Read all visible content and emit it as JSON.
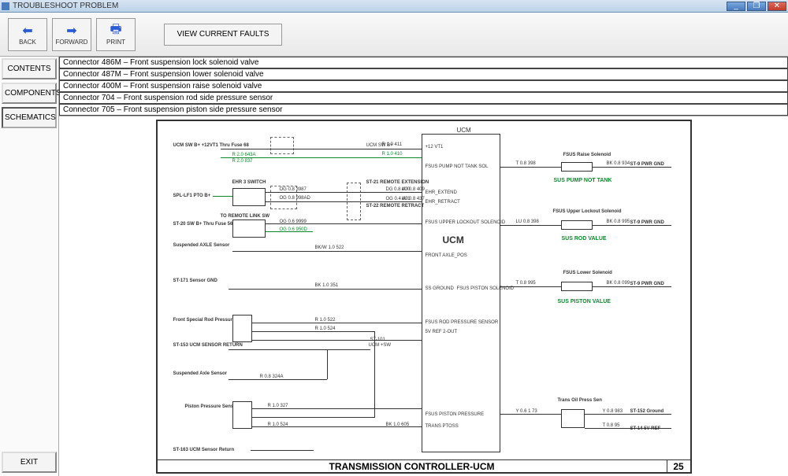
{
  "window": {
    "title": "TROUBLESHOOT PROBLEM",
    "minimize": "_",
    "maximize": "❐",
    "close": "✕"
  },
  "toolbar": {
    "back": {
      "label": "BACK",
      "glyph": "⬅"
    },
    "forward": {
      "label": "FORWARD",
      "glyph": "➡"
    },
    "print": {
      "label": "PRINT",
      "glyph": "🖶"
    },
    "view_faults": "VIEW CURRENT FAULTS"
  },
  "sidebar": {
    "contents": "CONTENTS",
    "components": "COMPONENTS",
    "schematics": "SCHEMATICS",
    "exit": "EXIT"
  },
  "connectors": [
    "Connector 486M – Front suspension lock solenoid valve",
    "Connector 487M – Front suspension lower solenoid valve",
    "Connector 400M – Front suspension raise solenoid valve",
    "Connector 704 – Front suspension rod side pressure sensor",
    "Connector 705 – Front suspension piston side pressure sensor"
  ],
  "schematic": {
    "title": "TRANSMISSION CONTROLLER-UCM",
    "page": "25",
    "ucm_heading": "UCM",
    "ucm_big": "UCM",
    "left": {
      "ucm_sw": "UCM SW B+\n+12VT1 Thru Fuse 68",
      "ehr_switch": "EHR 3 SWITCH",
      "spl": "SPL-LF1 PTO B+",
      "remote_link": "TO REMOTE LINK SW",
      "st20": "ST-20 SW B+ Thru\nFuse 56",
      "susp_axle": "Suspended AXLE Sensor",
      "st171": "ST-171 Sensor GND",
      "front_rod": "Front Special Rod\nPressure Sensor",
      "st153": "ST-153 UCM SENSOR RETURN",
      "susp_axle2": "Suspended Axle Sensor",
      "piston": "Piston\nPressure Sensor",
      "st163": "ST-163 UCM Sensor Return"
    },
    "mid": {
      "ucm_sw_b": "UCM SW B+",
      "st21": "ST-21\nREMOTE EXTENSION",
      "st22": "ST-22\nREMOTE RETRACT",
      "ucm_sw2": "UCM +SW",
      "st101": "ST-101"
    },
    "inside": {
      "v12": "+12 VT1",
      "pump": "FSUS PUMP NOT TANK SOL",
      "ehr_ext": "EHR_EXTEND",
      "ehr_ret": "EHR_RETRACT",
      "upper": "FSUS UPPER LOCKOUT SOLENOID",
      "axle_pos": "FRONT AXLE_POS",
      "ss_gnd": "SS GROUND",
      "piston_sol": "FSUS PISTON SOLENOID",
      "rod_press": "FSUS ROD PRESSURE SENSOR",
      "sv_ref": "5V REF 2-OUT",
      "piston_press": "FSUS PISTON PRESSURE",
      "trans": "TRANS PTOSS"
    },
    "right": {
      "raise": "FSUS Raise\nSolenoid",
      "st9a": "ST-9 PWR GND",
      "sus_pump": "SUS PUMP NOT TANK",
      "upper_lock": "FSUS Upper Lockout\nSolenoid",
      "st9b": "ST-9 PWR GND",
      "sus_rod": "SUS ROD VALUE",
      "lower": "FSUS Lower\nSolenoid",
      "st9c": "ST-9 PWR GND",
      "sus_piston": "SUS PISTON VALUE",
      "trans_oil": "Trans Oil Press\nSen",
      "st152": "ST-152 Ground",
      "st14": "ST-14 5V REF"
    },
    "wires": {
      "r10411": "R 1.0 411",
      "r10410": "R 1.0 410",
      "r20643a": "R 2.0 643A",
      "r20837": "R 2.0 837",
      "og083987": "OG 0.8 3987",
      "dg08400": "DG 0.8 400",
      "og04401": "OG 0.4 401",
      "og08998ad": "OG 0.8 998AD",
      "og069999": "OG 0.6 9999",
      "og06950d": "OG 0.6 950D",
      "lu08409": "LU 0.8 409",
      "lu08437": "LU 0.8 437",
      "bkw10522": "BK/W 1.0 522",
      "bk10351": "BK 1.0 351",
      "r10522a": "R 1.0 522",
      "r10524": "R 1.0 524",
      "r08324a": "R 0.8 324A",
      "r10327": "R 1.0 327",
      "r10524b": "R 1.0 524",
      "y06173": "Y 0.6 1 73",
      "bk08934": "BK 0.8 934",
      "t08398": "T 0.8 398",
      "lu08398": "LU 0.8 398",
      "t08995": "T 0.8 995",
      "bk08995": "BK 0.8 995",
      "bk08office": "BK 0.8 099",
      "y08983": "Y 0.8 983",
      "bk10605": "BK 1.0 605",
      "t0895": "T 0.8 95"
    }
  }
}
